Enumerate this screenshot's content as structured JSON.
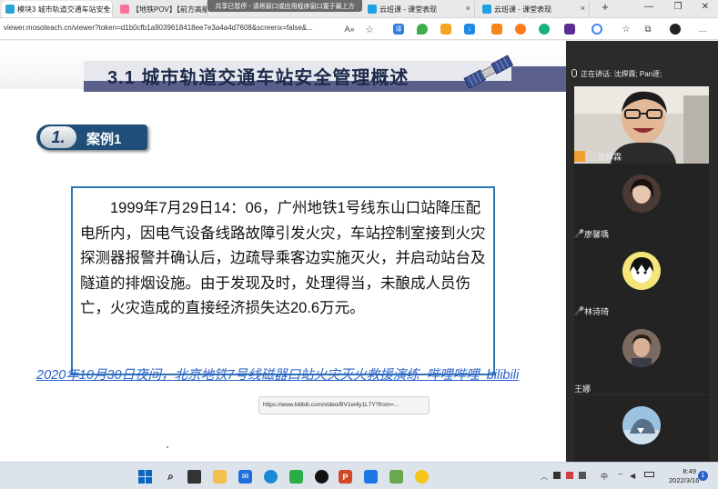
{
  "browser": {
    "tabs": [
      {
        "label": "模块3 城市轨道交通车站安全…",
        "favicon_color": "#2aa3d8",
        "active": true
      },
      {
        "label": "【地铁POV】【前方高能】",
        "favicon_color": "#fb7299",
        "active": false
      },
      {
        "label": "云班课 - 课堂表现",
        "favicon_color": "#1fa0e0",
        "active": false
      },
      {
        "label": "云班课 - 课堂表现",
        "favicon_color": "#1fa0e0",
        "active": false
      }
    ],
    "close_glyph": "×",
    "new_tab_glyph": "+",
    "share_banner": "共享已暂停 - 请将窗口或应用程序窗口置于最上方",
    "url": "viewer.mosoteach.cn/viewer?token=d1b0cfb1a9039618418ee7e3a4a4d7608&screenx=false&...",
    "window_controls": {
      "minimize": "—",
      "maximize": "❐",
      "close": "✕"
    }
  },
  "slide": {
    "title": "3.1  城市轨道交通车站安全管理概述",
    "case_number": "1.",
    "case_label": "案例1",
    "case_text": "1999年7月29日14：06，广州地铁1号线东山口站降压配电所内，因电气设备线路故障引发火灾，车站控制室接到火灾探测器报警并确认后，边疏导乘客边实施灭火，并启动站台及隧道的排烟设施。由于发现及时，处理得当，未酿成人员伤亡，火灾造成的直接经济损失达20.6万元。",
    "video_link": "2020年10月30日夜间，北京地铁7号线磁器口站火灾灭火救援演练_哔哩哔哩_bilibili",
    "hover_url": "https://www.bilibili.com/video/BV1ei4y1L7Y?from=..."
  },
  "meeting": {
    "speaking_label": "正在讲话: 沈焊霖; Pan逐;",
    "participants": [
      {
        "name": "沈焊霖"
      },
      {
        "name": "廖馨瑀"
      },
      {
        "name": "林诗琦"
      },
      {
        "name": "王娜"
      }
    ]
  },
  "taskbar": {
    "time": "8:49",
    "date": "2022/3/16",
    "ime": "中",
    "notification_count": "1"
  },
  "colors": {
    "accent_blue": "#2e75b6",
    "badge_navy": "#1f4e79",
    "header_band": "#5b5f8c",
    "link_blue": "#2a62c9"
  }
}
